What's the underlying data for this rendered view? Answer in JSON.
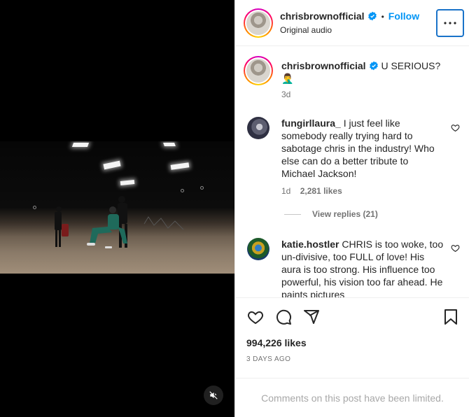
{
  "post": {
    "username": "chrisbrownofficial",
    "follow_label": "Follow",
    "separator": "•",
    "audio_label": "Original audio"
  },
  "caption": {
    "username": "chrisbrownofficial",
    "text": "U SERIOUS?",
    "emoji": "🤦‍♂️",
    "time": "3d"
  },
  "comments": [
    {
      "username": "fungirllaura_",
      "text": "I just feel like somebody really trying hard to sabotage chris in the industry! Who else can do a better tribute to Michael Jackson!",
      "time": "1d",
      "likes": "2,281 likes",
      "replies": "View replies (21)"
    },
    {
      "username": "katie.hostler",
      "text": "CHRIS is too woke, too un-divisive, too FULL of love! His aura is too strong. His influence too powerful, his vision too far ahead. He paints pictures"
    }
  ],
  "footer": {
    "likes": "994,226 likes",
    "date": "3 DAYS AGO",
    "comments_limited": "Comments on this post have been limited."
  },
  "colors": {
    "accent": "#0095f6",
    "verified": "#0095f6",
    "focus_ring": "#1a73c9"
  },
  "icons": [
    "verified-badge-icon",
    "more-options-icon",
    "heart-icon",
    "comment-icon",
    "share-icon",
    "bookmark-icon",
    "muted-speaker-icon"
  ]
}
